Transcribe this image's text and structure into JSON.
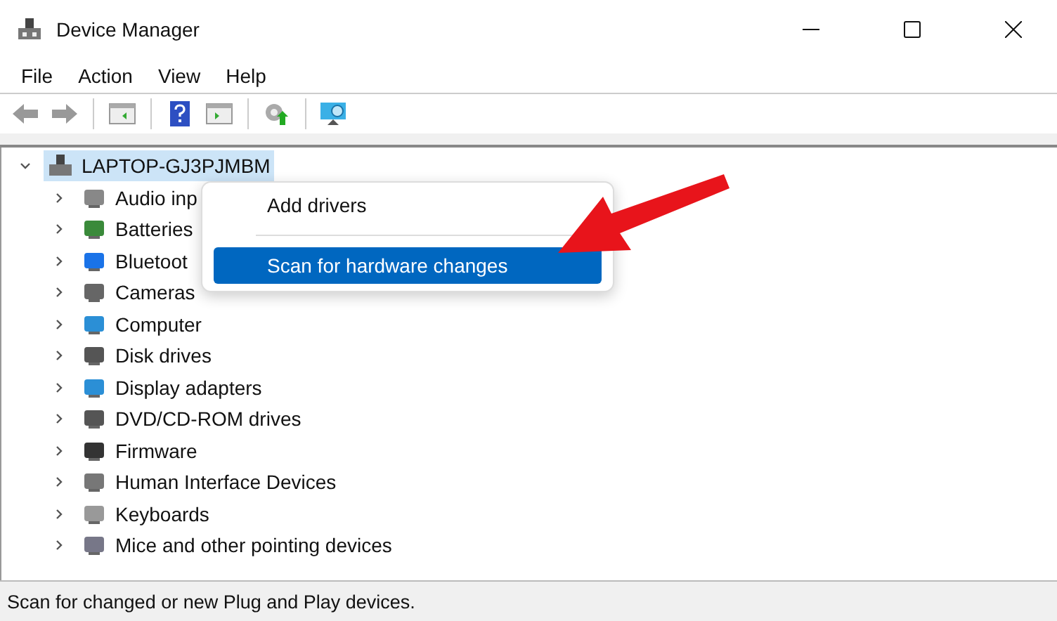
{
  "window": {
    "title": "Device Manager"
  },
  "menu": [
    "File",
    "Action",
    "View",
    "Help"
  ],
  "tree": {
    "label": "LAPTOP-GJ3PJMBM",
    "expanded": true,
    "selected": true,
    "children": [
      {
        "label": "Audio inp",
        "expanded": false
      },
      {
        "label": "Batteries",
        "expanded": false
      },
      {
        "label": "Bluetoot",
        "expanded": false
      },
      {
        "label": "Cameras",
        "expanded": false
      },
      {
        "label": "Computer",
        "expanded": false
      },
      {
        "label": "Disk drives",
        "expanded": false
      },
      {
        "label": "Display adapters",
        "expanded": false
      },
      {
        "label": "DVD/CD-ROM drives",
        "expanded": false
      },
      {
        "label": "Firmware",
        "expanded": false
      },
      {
        "label": "Human Interface Devices",
        "expanded": false
      },
      {
        "label": "Keyboards",
        "expanded": false
      },
      {
        "label": "Mice and other pointing devices",
        "expanded": false
      }
    ]
  },
  "context_menu": [
    {
      "label": "Add drivers",
      "selected": false
    },
    {
      "label": "Scan for hardware changes",
      "selected": true
    }
  ],
  "status_bar": "Scan for changed or new Plug and Play devices."
}
